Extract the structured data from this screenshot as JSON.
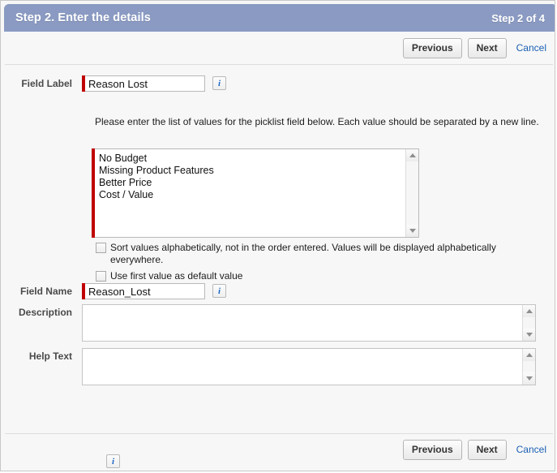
{
  "header": {
    "title": "Step 2. Enter the details",
    "step_count": "Step 2 of 4",
    "bg_color": "#8a9ac2"
  },
  "toolbar_top": {
    "previous_label": "Previous",
    "next_label": "Next",
    "cancel_label": "Cancel"
  },
  "toolbar_bottom": {
    "previous_label": "Previous",
    "next_label": "Next",
    "cancel_label": "Cancel"
  },
  "form": {
    "field_label": {
      "label": "Field Label",
      "value": "Reason Lost",
      "required": true,
      "info_icon": "info-icon",
      "info_glyph": "i"
    },
    "instruction": "Please enter the list of values for the picklist field below. Each value should be separated by a new line.",
    "picklist": {
      "values_text": "No Budget\nMissing Product Features\nBetter Price\nCost / Value",
      "values": [
        "No Budget",
        "Missing Product Features",
        "Better Price",
        "Cost / Value"
      ],
      "required": true,
      "scrollbar": {
        "up_icon": "scroll-up-arrow-icon",
        "down_icon": "scroll-down-arrow-icon"
      }
    },
    "sort_checkbox": {
      "label": "Sort values alphabetically, not in the order entered. Values will be displayed alphabetically everywhere.",
      "checked": false
    },
    "default_checkbox": {
      "label": "Use first value as default value",
      "checked": false
    },
    "field_name": {
      "label": "Field Name",
      "value": "Reason_Lost",
      "required": true,
      "info_icon": "info-icon",
      "info_glyph": "i"
    },
    "description": {
      "label": "Description",
      "value": "",
      "scrollbar": {
        "up_icon": "scroll-up-arrow-icon",
        "down_icon": "scroll-down-arrow-icon"
      }
    },
    "help_text": {
      "label": "Help Text",
      "value": "",
      "scrollbar": {
        "up_icon": "scroll-up-arrow-icon",
        "down_icon": "scroll-down-arrow-icon"
      }
    },
    "help_info": {
      "info_icon": "info-icon",
      "info_glyph": "i"
    }
  },
  "colors": {
    "header_bg": "#8a9ac2",
    "required_bar": "#c00000",
    "link": "#1a5fb4",
    "page_bg": "#f7f7f7"
  }
}
